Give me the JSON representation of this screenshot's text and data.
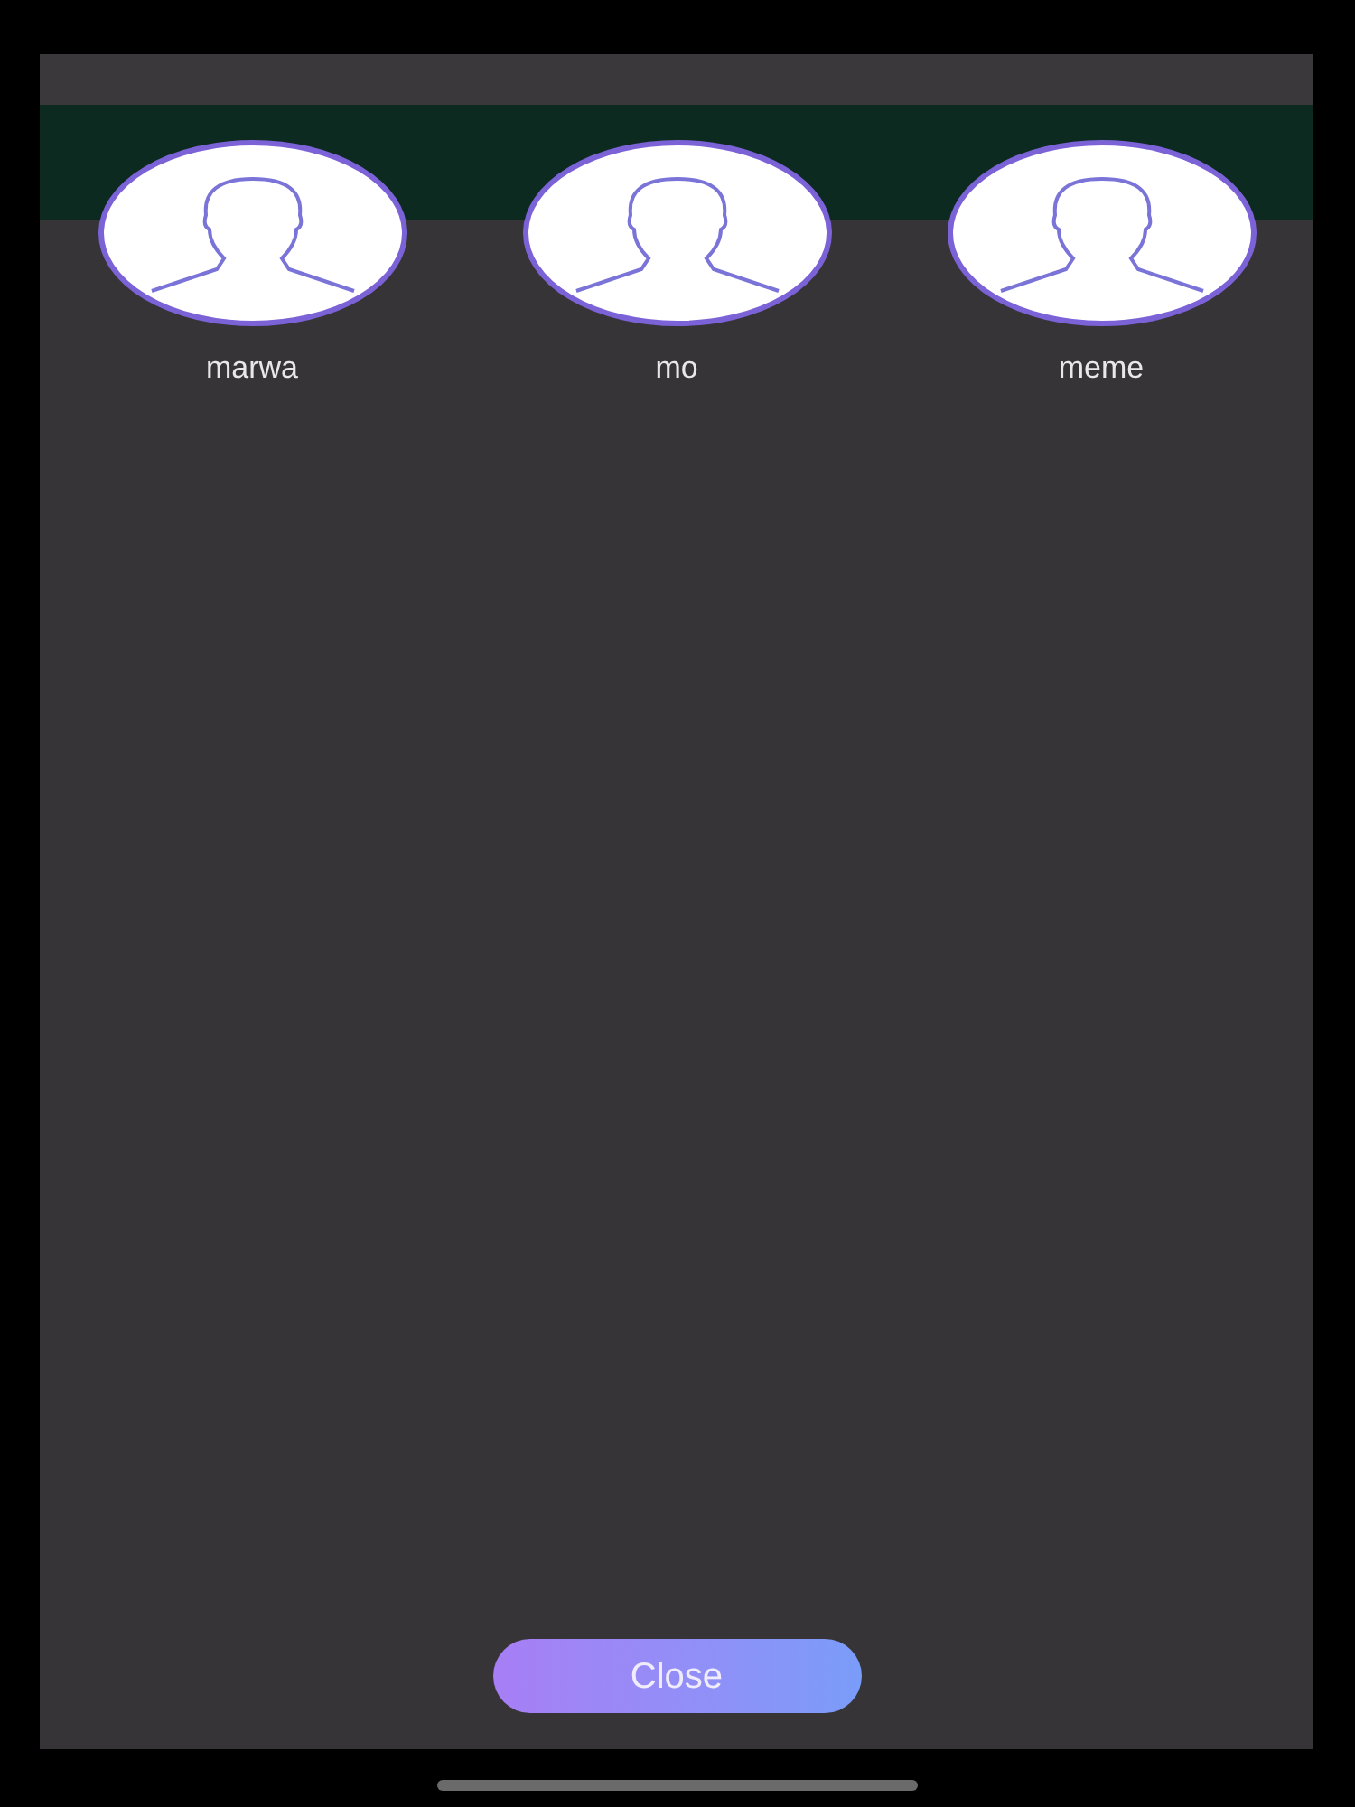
{
  "contacts": [
    {
      "name": "marwa"
    },
    {
      "name": "mo"
    },
    {
      "name": "meme"
    }
  ],
  "close_button": {
    "label": "Close"
  }
}
